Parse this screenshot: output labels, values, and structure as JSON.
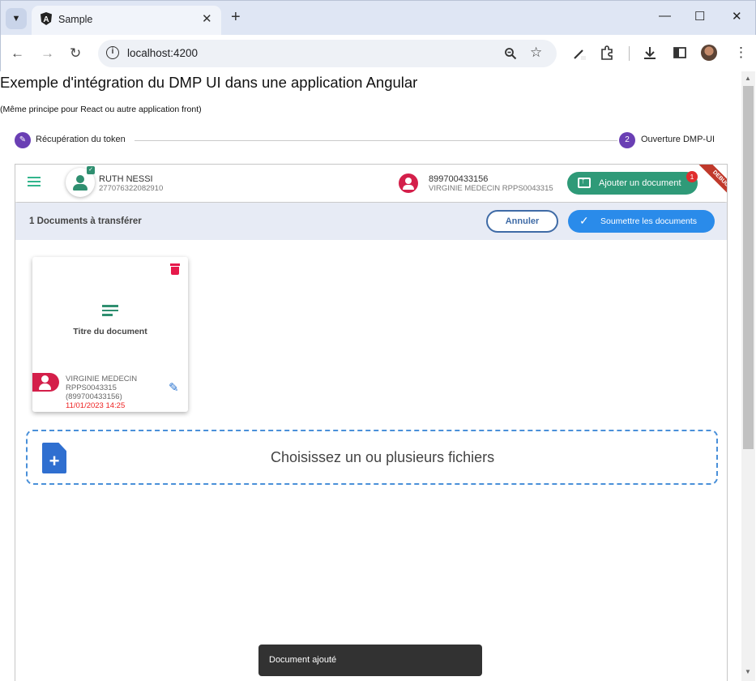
{
  "browser": {
    "tab_title": "Sample",
    "url": "localhost:4200",
    "new_tab_symbol": "+",
    "tab_close_symbol": "✕",
    "window_controls": {
      "minimize": "—",
      "maximize": "☐",
      "close": "✕"
    }
  },
  "page": {
    "title": "Exemple d'intégration du DMP UI dans une application Angular",
    "subtitle": "(Même principe pour React ou autre application front)"
  },
  "stepper": {
    "steps": [
      {
        "marker": "✎",
        "label": "Récupération du token"
      },
      {
        "marker": "2",
        "label": "Ouverture DMP-UI"
      }
    ]
  },
  "app": {
    "patient": {
      "name": "RUTH NESSI",
      "id": "277076322082910"
    },
    "doctor": {
      "number": "899700433156",
      "name": "VIRGINIE MEDECIN RPPS0043315"
    },
    "add_document_label": "Ajouter un document",
    "add_document_badge": "1",
    "debug_ribbon": "DEBUG",
    "documents_count_label": "1 Documents à transférer",
    "cancel_label": "Annuler",
    "submit_label": "Soumettre les documents",
    "document_card": {
      "title": "Titre du document",
      "author": "VIRGINIE MEDECIN RPPS0043315 (899700433156)",
      "date": "11/01/2023 14:25"
    },
    "dropzone_label": "Choisissez un ou plusieurs fichiers",
    "snackbar_text": "Document ajouté"
  },
  "colors": {
    "stepper_accent": "#6a3fb4",
    "primary_green": "#2f9a78",
    "primary_blue": "#2a8bea",
    "danger_red": "#e6194b"
  }
}
